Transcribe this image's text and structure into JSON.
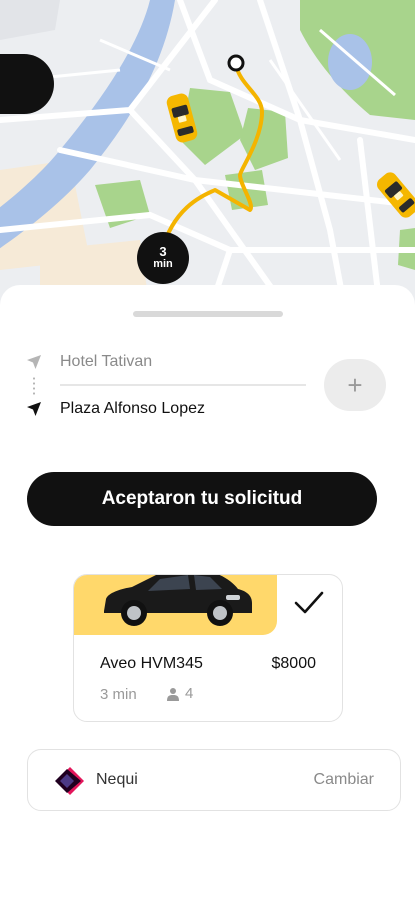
{
  "map": {
    "eta_number": "3",
    "eta_unit": "min"
  },
  "route": {
    "origin": "Hotel Tativan",
    "destination": "Plaza Alfonso Lopez",
    "add_stop": "+"
  },
  "status": {
    "message": "Aceptaron tu solicitud"
  },
  "ride": {
    "vehicle": "Aveo HVM345",
    "price": "$8000",
    "eta": "3 min",
    "seats": "4"
  },
  "payment": {
    "method": "Nequi",
    "change_label": "Cambiar"
  },
  "colors": {
    "accent_yellow": "#ffd86b",
    "route_line": "#f4b400",
    "dark": "#111111"
  }
}
